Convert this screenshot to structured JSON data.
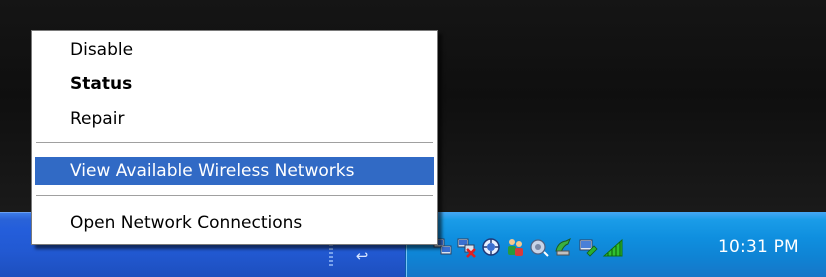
{
  "context_menu": {
    "items": [
      {
        "label": "Disable"
      },
      {
        "label": "Status"
      },
      {
        "label": "Repair"
      },
      {
        "label": "View Available Wireless Networks"
      },
      {
        "label": "Open Network Connections"
      }
    ],
    "highlighted_item": "View Available Wireless Networks",
    "default_item": "Status",
    "highlight_color": "#316ac5"
  },
  "taskbar": {
    "quick_launch_icon": "arrow-icon",
    "tray_icons": [
      "network-connection-icon",
      "network-disconnected-icon",
      "security-center-icon",
      "users-icon",
      "volume-icon",
      "safely-remove-hardware-icon",
      "wireless-network-icon",
      "signal-strength-icon"
    ],
    "clock": "10:31 PM",
    "color": "#245edb",
    "tray_color": "#0f8fdf"
  }
}
